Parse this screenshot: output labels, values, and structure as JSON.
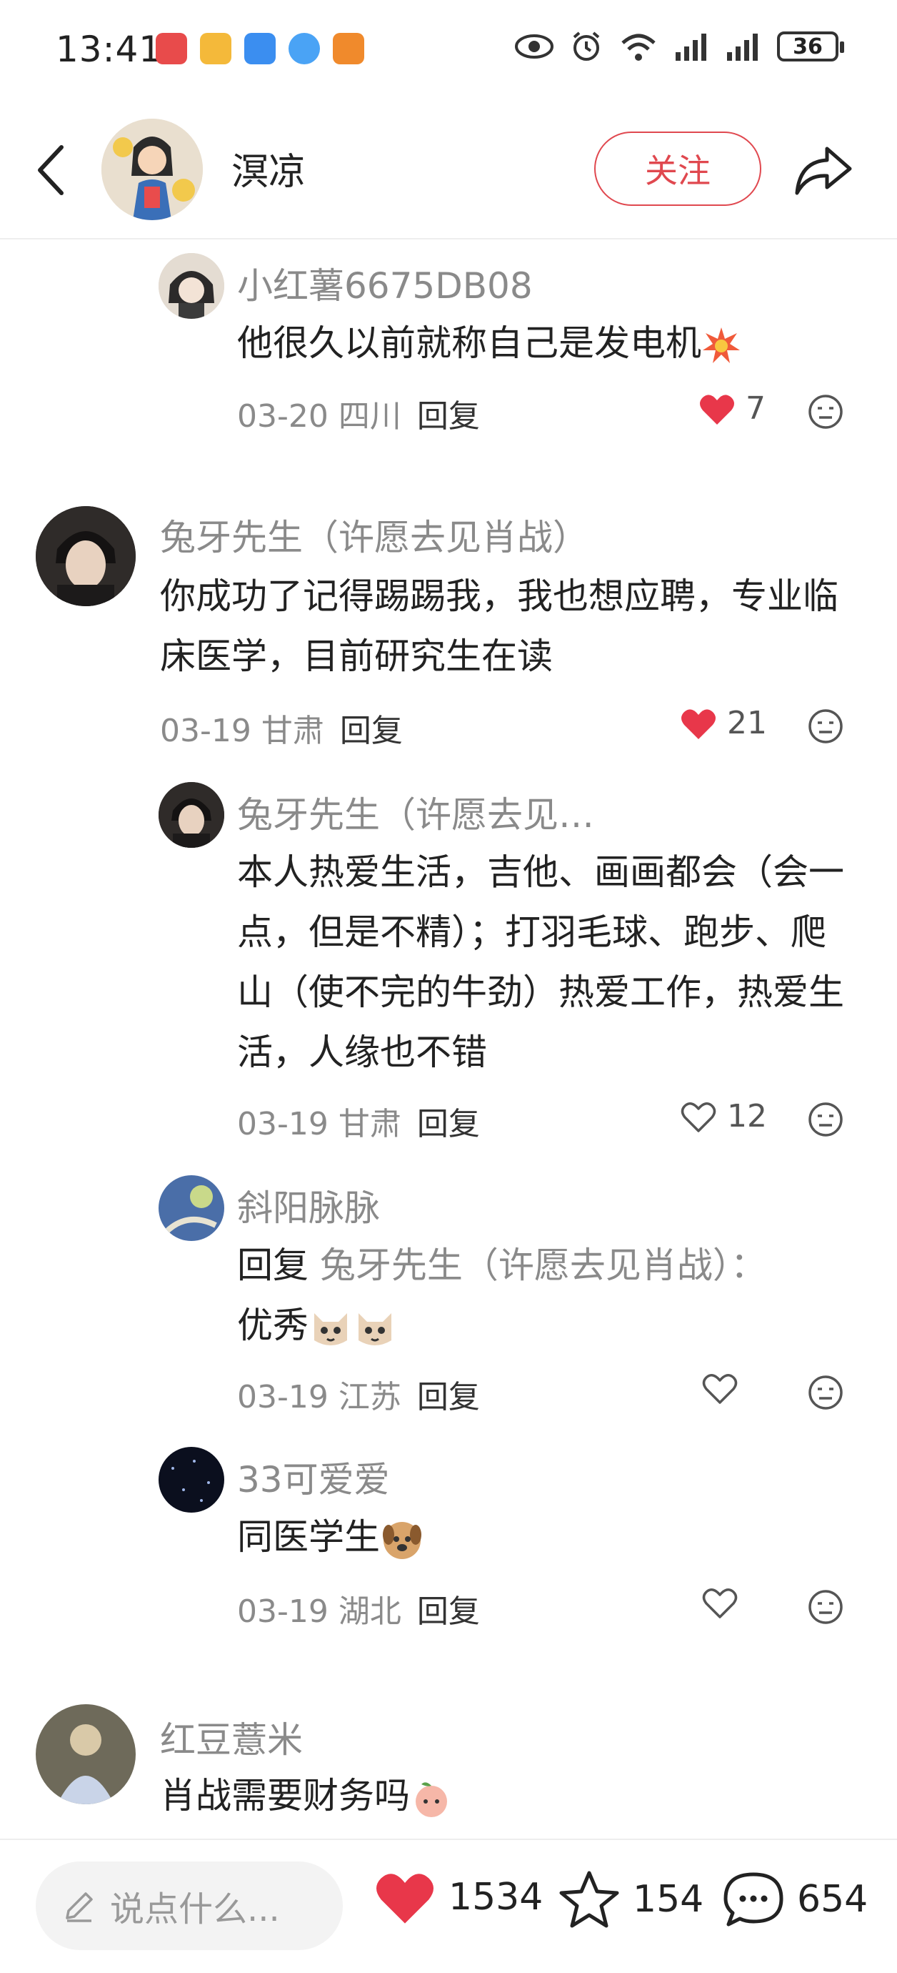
{
  "status_bar": {
    "time": "13:41",
    "battery": "36"
  },
  "header": {
    "author_name": "溟凉",
    "follow_label": "关注"
  },
  "comments": [
    {
      "username": "小红薯6675DB08",
      "text": "他很久以前就称自己是发电机",
      "date_loc": "03-20 四川",
      "reply_label": "回复",
      "likes": "7"
    },
    {
      "username": "兔牙先生（许愿去见肖战）",
      "text": "你成功了记得踢踢我，我也想应聘，专业临床医学，目前研究生在读",
      "date_loc": "03-19 甘肃",
      "reply_label": "回复",
      "likes": "21"
    },
    {
      "username": "兔牙先生（许愿去见…",
      "text": "本人热爱生活，吉他、画画都会（会一点，但是不精）；打羽毛球、跑步、爬山（使不完的牛劲）热爱工作，热爱生活，人缘也不错",
      "date_loc": "03-19 甘肃",
      "reply_label": "回复",
      "likes": "12"
    },
    {
      "username": "斜阳脉脉",
      "reply_prefix": "回复",
      "reply_to": "兔牙先生（许愿去见肖战）：",
      "text": "优秀",
      "date_loc": "03-19 江苏",
      "reply_label": "回复"
    },
    {
      "username": "33可爱爱",
      "text": "同医学生",
      "date_loc": "03-19 湖北",
      "reply_label": "回复"
    },
    {
      "username": "红豆薏米",
      "text": "肖战需要财务吗"
    }
  ],
  "bottom_bar": {
    "input_placeholder": "说点什么...",
    "likes": "1534",
    "stars": "154",
    "comments": "654"
  },
  "colors": {
    "accent_red": "#e0484f",
    "gray_text": "#8a8a8a"
  }
}
